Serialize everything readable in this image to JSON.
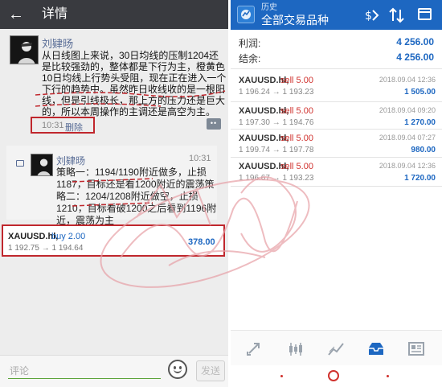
{
  "left": {
    "header": {
      "back": "←",
      "title": "详情"
    },
    "post": {
      "author": "刘肄旸",
      "text": "从日线图上来说，30日均线的压制1204还是比较强劲的，整体都是下行为主，橙黄色10日均线上行势头受阻，现在正在进入一个下行的趋势中。虽然昨日收线收的是一根阳线，但是引线极长，那上方的压力还是巨大的，所以本周操作的主调还是高空为主。",
      "time": "10:31",
      "delete_label": "删除",
      "more_icon": "••"
    },
    "comment": {
      "author": "刘肄旸",
      "time": "10:31",
      "text": "策略一：1194/1190附近做多，止损1187，目标还是看1200附近的震荡策略二：1204/1208附近做空，止损1210，目标看破1200之后看到1196附近，震荡为主"
    },
    "trade_card": {
      "symbol": "XAUUSD.hl,",
      "type": "buy 2.00",
      "prices": "1 192.75 → 1 194.64",
      "profit": "378.00"
    },
    "input": {
      "placeholder": "评论",
      "send_label": "发送"
    }
  },
  "right": {
    "header": {
      "subtitle": "历史",
      "title": "全部交易品种"
    },
    "summary": [
      {
        "label": "利润:",
        "value": "4 256.00"
      },
      {
        "label": "结余:",
        "value": "4 256.00"
      }
    ],
    "trades": [
      {
        "symbol": "XAUUSD.hl,",
        "type": "sell 5.00",
        "date": "2018.09.04 12:36",
        "prices": "1 196.24 → 1 193.23",
        "profit": "1 505.00"
      },
      {
        "symbol": "XAUUSD.hl,",
        "type": "sell 5.00",
        "date": "2018.09.04 09:20",
        "prices": "1 197.30 → 1 194.76",
        "profit": "1 270.00"
      },
      {
        "symbol": "XAUUSD.hl,",
        "type": "sell 5.00",
        "date": "2018.09.04 07:27",
        "prices": "1 199.74 → 1 197.78",
        "profit": "980.00"
      },
      {
        "symbol": "XAUUSD.hl,",
        "type": "sell 5.00",
        "date": "2018.09.04 12:36",
        "prices": "1 196.67 → 1 193.23",
        "profit": "1 720.00"
      }
    ],
    "toolbar_icons": [
      "quotes-icon",
      "chart-icon",
      "trade-icon",
      "history-icon",
      "news-icon"
    ]
  },
  "colors": {
    "accent_blue": "#1d67c1",
    "sell_red": "#d0312d",
    "highlight_red": "#c0272d",
    "wechat_dark": "#393a3f"
  }
}
